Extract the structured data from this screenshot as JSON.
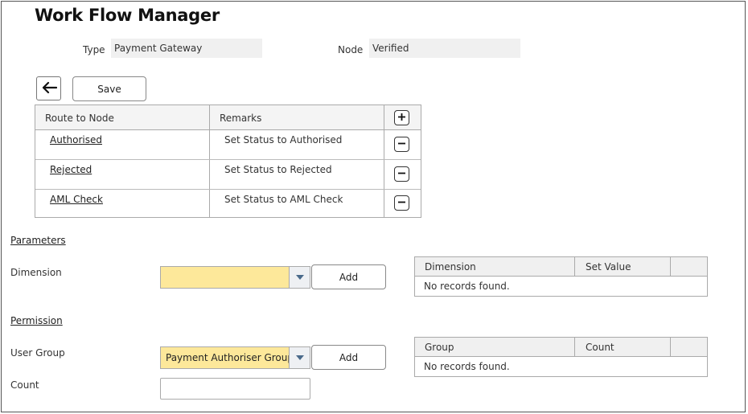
{
  "header": {
    "title": "Work Flow Manager"
  },
  "info": {
    "type_label": "Type",
    "type_value": "Payment Gateway",
    "node_label": "Node",
    "node_value": "Verified"
  },
  "toolbar": {
    "back_icon": "arrow-left-icon",
    "save_label": "Save"
  },
  "route_table": {
    "columns": [
      "Route to Node",
      "Remarks"
    ],
    "add_icon": "plus-icon",
    "remove_icon": "minus-icon",
    "rows": [
      {
        "node": "Authorised",
        "remark": "Set Status to Authorised"
      },
      {
        "node": "Rejected",
        "remark": "Set Status to Rejected"
      },
      {
        "node": "AML Check",
        "remark": "Set Status to AML Check"
      }
    ]
  },
  "parameters": {
    "section_label": "Parameters",
    "dimension_label": "Dimension",
    "dimension_value": "",
    "add_label": "Add",
    "table": {
      "columns": [
        "Dimension",
        "Set Value",
        ""
      ],
      "empty_text": "No records found."
    }
  },
  "permission": {
    "section_label": "Permission",
    "user_group_label": "User Group",
    "user_group_value": "Payment Authoriser Group",
    "add_label": "Add",
    "count_label": "Count",
    "count_value": "",
    "table": {
      "columns": [
        "Group",
        "Count",
        ""
      ],
      "empty_text": "No records found."
    }
  },
  "colors": {
    "select_bg": "#fde89a",
    "readonly_bg": "#f0f0f0",
    "border": "#aaaaaa"
  }
}
